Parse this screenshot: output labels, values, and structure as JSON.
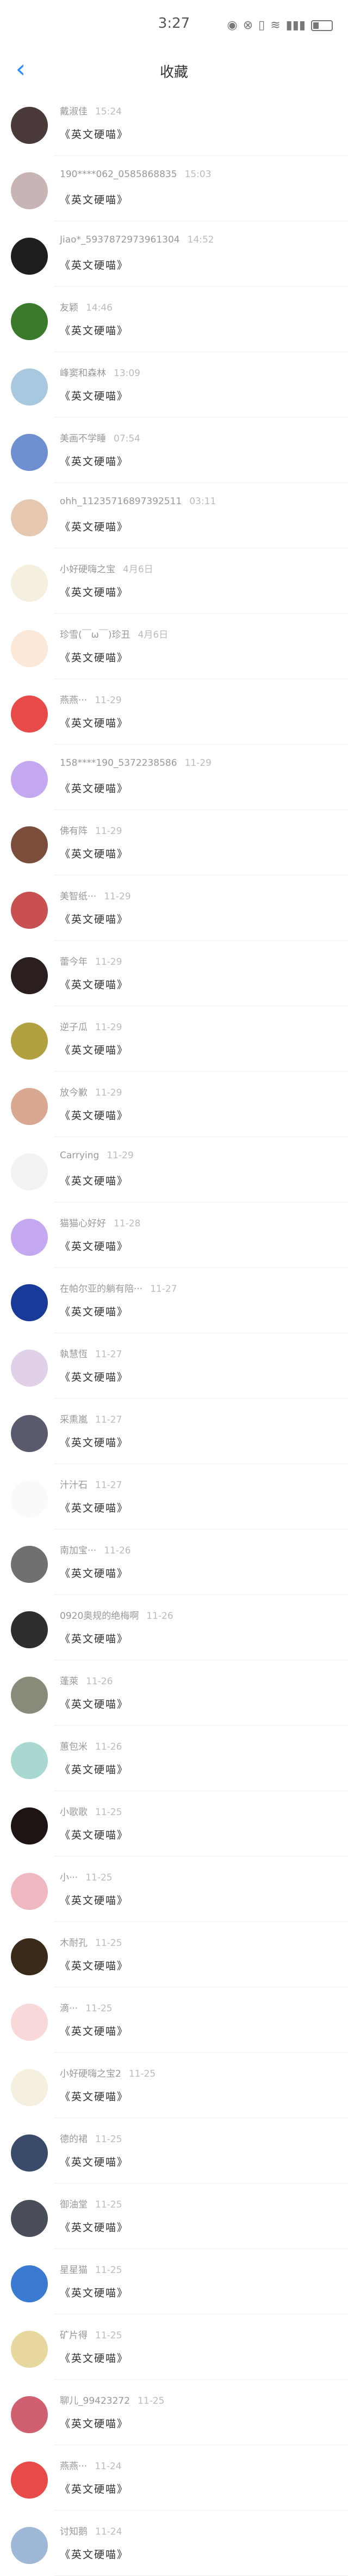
{
  "status_bar": {
    "time": "3:27"
  },
  "nav": {
    "title": "收藏"
  },
  "items": [
    {
      "user": "戴淑佳",
      "time": "15:24",
      "subject": "《英文硬喵》",
      "color": "#4a3a3a"
    },
    {
      "user": "190****062_0585868835",
      "time": "15:03",
      "subject": "《英文硬喵》",
      "color": "#c8b4b4"
    },
    {
      "user": "Jiao*_5937872973961304",
      "time": "14:52",
      "subject": "《英文硬喵》",
      "color": "#1e1e1e"
    },
    {
      "user": "友颖",
      "time": "14:46",
      "subject": "《英文硬喵》",
      "color": "#3a7a2a"
    },
    {
      "user": "峰窦和森林",
      "time": "13:09",
      "subject": "《英文硬喵》",
      "color": "#a8c8e0"
    },
    {
      "user": "美画不学睡",
      "time": "07:54",
      "subject": "《英文硬喵》",
      "color": "#6e8fd0"
    },
    {
      "user": "ohh_11235716897392511",
      "time": "03:11",
      "subject": "《英文硬喵》",
      "color": "#e6c7b0"
    },
    {
      "user": "小好硬嗨之宝",
      "time": "4月6日",
      "subject": "《英文硬喵》",
      "color": "#f5efe0"
    },
    {
      "user": "珍雪(￣ω￣)珍丑",
      "time": "4月6日",
      "subject": "《英文硬喵》",
      "color": "#fbe8d8"
    },
    {
      "user": "燕燕···",
      "time": "11-29",
      "subject": "《英文硬喵》",
      "color": "#e84a4a"
    },
    {
      "user": "158****190_5372238586",
      "time": "11-29",
      "subject": "《英文硬喵》",
      "color": "#c4a8f0"
    },
    {
      "user": "佛有阵",
      "time": "11-29",
      "subject": "《英文硬喵》",
      "color": "#7a4e3a"
    },
    {
      "user": "美智纸···",
      "time": "11-29",
      "subject": "《英文硬喵》",
      "color": "#c85050"
    },
    {
      "user": "蕾今年",
      "time": "11-29",
      "subject": "《英文硬喵》",
      "color": "#2a1e1e"
    },
    {
      "user": "逆子瓜",
      "time": "11-29",
      "subject": "《英文硬喵》",
      "color": "#b0a040"
    },
    {
      "user": "放今歉",
      "time": "11-29",
      "subject": "《英文硬喵》",
      "color": "#d8a890"
    },
    {
      "user": "Carrying",
      "time": "11-29",
      "subject": "《英文硬喵》",
      "color": "#f2f2f2"
    },
    {
      "user": "猫猫心好好",
      "time": "11-28",
      "subject": "《英文硬喵》",
      "color": "#c4a8f0"
    },
    {
      "user": "在帕尔亚的躺有陪···",
      "time": "11-27",
      "subject": "《英文硬喵》",
      "color": "#1a3a9a"
    },
    {
      "user": "執慧恆",
      "time": "11-27",
      "subject": "《英文硬喵》",
      "color": "#e0d0e8"
    },
    {
      "user": "采熏嵐",
      "time": "11-27",
      "subject": "《英文硬喵》",
      "color": "#5a5a6e"
    },
    {
      "user": "汁汁石",
      "time": "11-27",
      "subject": "《英文硬喵》",
      "color": "#fafafa"
    },
    {
      "user": "南加宝···",
      "time": "11-26",
      "subject": "《英文硬喵》",
      "color": "#707070"
    },
    {
      "user": "0920奥规的绝梅啊",
      "time": "11-26",
      "subject": "《英文硬喵》",
      "color": "#2e2e2e"
    },
    {
      "user": "蓬萊",
      "time": "11-26",
      "subject": "《英文硬喵》",
      "color": "#8a8a7a"
    },
    {
      "user": "蕙包米",
      "time": "11-26",
      "subject": "《英文硬喵》",
      "color": "#a8d8d0"
    },
    {
      "user": "小歌歌",
      "time": "11-25",
      "subject": "《英文硬喵》",
      "color": "#1e1414"
    },
    {
      "user": "小···",
      "time": "11-25",
      "subject": "《英文硬喵》",
      "color": "#f0b8c0"
    },
    {
      "user": "木耐孔",
      "time": "11-25",
      "subject": "《英文硬喵》",
      "color": "#3a2a1a"
    },
    {
      "user": "滴···",
      "time": "11-25",
      "subject": "《英文硬喵》",
      "color": "#f8d8d8"
    },
    {
      "user": "小好硬嗨之宝2",
      "time": "11-25",
      "subject": "《英文硬喵》",
      "color": "#f5efe0"
    },
    {
      "user": "德的裙",
      "time": "11-25",
      "subject": "《英文硬喵》",
      "color": "#3a4a6a"
    },
    {
      "user": "御油堂",
      "time": "11-25",
      "subject": "《英文硬喵》",
      "color": "#4a4e5a"
    },
    {
      "user": "星星猫",
      "time": "11-25",
      "subject": "《英文硬喵》",
      "color": "#3a7ad0"
    },
    {
      "user": "矿片得",
      "time": "11-25",
      "subject": "《英文硬喵》",
      "color": "#e8d8a0"
    },
    {
      "user": "聊儿_99423272",
      "time": "11-25",
      "subject": "《英文硬喵》",
      "color": "#d06070"
    },
    {
      "user": "燕燕···",
      "time": "11-24",
      "subject": "《英文硬喵》",
      "color": "#e84a4a"
    },
    {
      "user": "讨知鹅",
      "time": "11-24",
      "subject": "《英文硬喵》",
      "color": "#a0b8d8"
    }
  ]
}
